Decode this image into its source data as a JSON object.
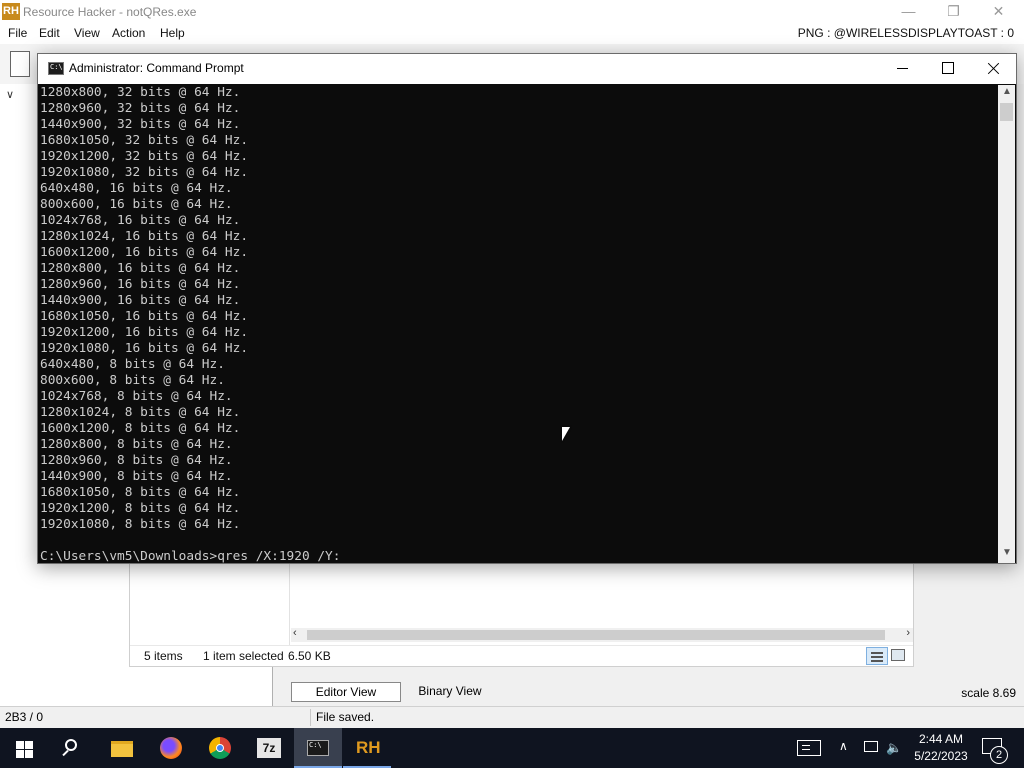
{
  "resource_hacker": {
    "logo_text": "RH",
    "title": "Resource Hacker - notQRes.exe",
    "menu": [
      "File",
      "Edit",
      "View",
      "Action",
      "Help"
    ],
    "resource_label": "PNG : @WIRELESSDISPLAYTOAST : 0",
    "explorer_status": {
      "items": "5 items",
      "selected": "1 item selected",
      "size": "6.50 KB"
    },
    "tabs": {
      "editor": "Editor View",
      "binary": "Binary View"
    },
    "scale": "scale 8.69",
    "status_left": "2B3 / 0",
    "status_message": "File saved."
  },
  "command_prompt": {
    "title": "Administrator: Command Prompt",
    "lines": [
      "1280x800, 32 bits @ 64 Hz.",
      "1280x960, 32 bits @ 64 Hz.",
      "1440x900, 32 bits @ 64 Hz.",
      "1680x1050, 32 bits @ 64 Hz.",
      "1920x1200, 32 bits @ 64 Hz.",
      "1920x1080, 32 bits @ 64 Hz.",
      "640x480, 16 bits @ 64 Hz.",
      "800x600, 16 bits @ 64 Hz.",
      "1024x768, 16 bits @ 64 Hz.",
      "1280x1024, 16 bits @ 64 Hz.",
      "1600x1200, 16 bits @ 64 Hz.",
      "1280x800, 16 bits @ 64 Hz.",
      "1280x960, 16 bits @ 64 Hz.",
      "1440x900, 16 bits @ 64 Hz.",
      "1680x1050, 16 bits @ 64 Hz.",
      "1920x1200, 16 bits @ 64 Hz.",
      "1920x1080, 16 bits @ 64 Hz.",
      "640x480, 8 bits @ 64 Hz.",
      "800x600, 8 bits @ 64 Hz.",
      "1024x768, 8 bits @ 64 Hz.",
      "1280x1024, 8 bits @ 64 Hz.",
      "1600x1200, 8 bits @ 64 Hz.",
      "1280x800, 8 bits @ 64 Hz.",
      "1280x960, 8 bits @ 64 Hz.",
      "1440x900, 8 bits @ 64 Hz.",
      "1680x1050, 8 bits @ 64 Hz.",
      "1920x1200, 8 bits @ 64 Hz.",
      "1920x1080, 8 bits @ 64 Hz.",
      "",
      "C:\\Users\\vm5\\Downloads>qres /X:1920 /Y:"
    ],
    "icon_text": "C:\\"
  },
  "taskbar": {
    "apps": [
      "start-icon",
      "search-icon",
      "file-explorer-icon",
      "firefox-icon",
      "chrome-icon",
      "7zip-icon",
      "command-prompt-icon",
      "resource-hacker-icon"
    ],
    "sevenzip_label": "7z",
    "rh_label": "RH",
    "time": "2:44 AM",
    "date": "5/22/2023",
    "notification_count": "2"
  },
  "colors": {
    "console_background": "#0c0c0c",
    "console_text": "#cccccc",
    "taskbar": "#0f1420",
    "accent": "#7aa7e8"
  }
}
